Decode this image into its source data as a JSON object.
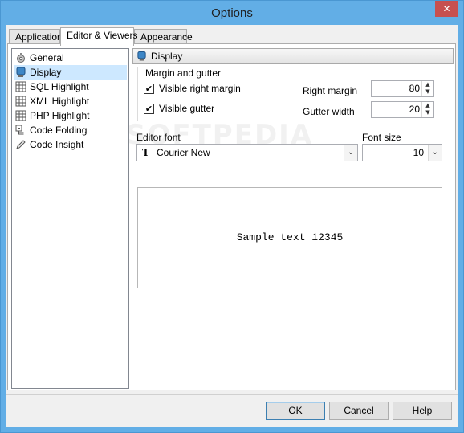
{
  "window": {
    "title": "Options",
    "close_glyph": "✕"
  },
  "tabs": [
    {
      "label": "Application",
      "mnemonic_index": 0,
      "active": false
    },
    {
      "label": "Editor & Viewers",
      "active": true
    },
    {
      "label": "Appearance",
      "active": false
    }
  ],
  "categories": [
    {
      "label": "General",
      "icon": "gears-icon",
      "selected": false
    },
    {
      "label": "Display",
      "icon": "monitor-icon",
      "selected": true
    },
    {
      "label": "SQL Highlight",
      "icon": "grid-icon",
      "selected": false
    },
    {
      "label": "XML Highlight",
      "icon": "grid-icon",
      "selected": false
    },
    {
      "label": "PHP Highlight",
      "icon": "grid-icon",
      "selected": false
    },
    {
      "label": "Code Folding",
      "icon": "code-folding-icon",
      "selected": false
    },
    {
      "label": "Code Insight",
      "icon": "pencil-icon",
      "selected": false
    }
  ],
  "display": {
    "header": "Display",
    "margin_group": {
      "title": "Margin and gutter",
      "visible_right_margin": {
        "label": "Visible right margin",
        "checked": true
      },
      "visible_gutter": {
        "label": "Visible gutter",
        "checked": true
      },
      "right_margin": {
        "label": "Right margin",
        "value": "80"
      },
      "gutter_width": {
        "label": "Gutter width",
        "value": "20"
      }
    },
    "editor_font": {
      "label": "Editor font",
      "value": "Courier New",
      "icon": "truetype-font-icon"
    },
    "font_size": {
      "label": "Font size",
      "value": "10"
    },
    "preview_text": "Sample text 12345"
  },
  "buttons": {
    "ok": "OK",
    "cancel": "Cancel",
    "help": "Help"
  },
  "watermark": "SOFTPEDIA",
  "colors": {
    "titlebar": "#62aee6",
    "close": "#c75050",
    "selection": "#cde8ff"
  }
}
